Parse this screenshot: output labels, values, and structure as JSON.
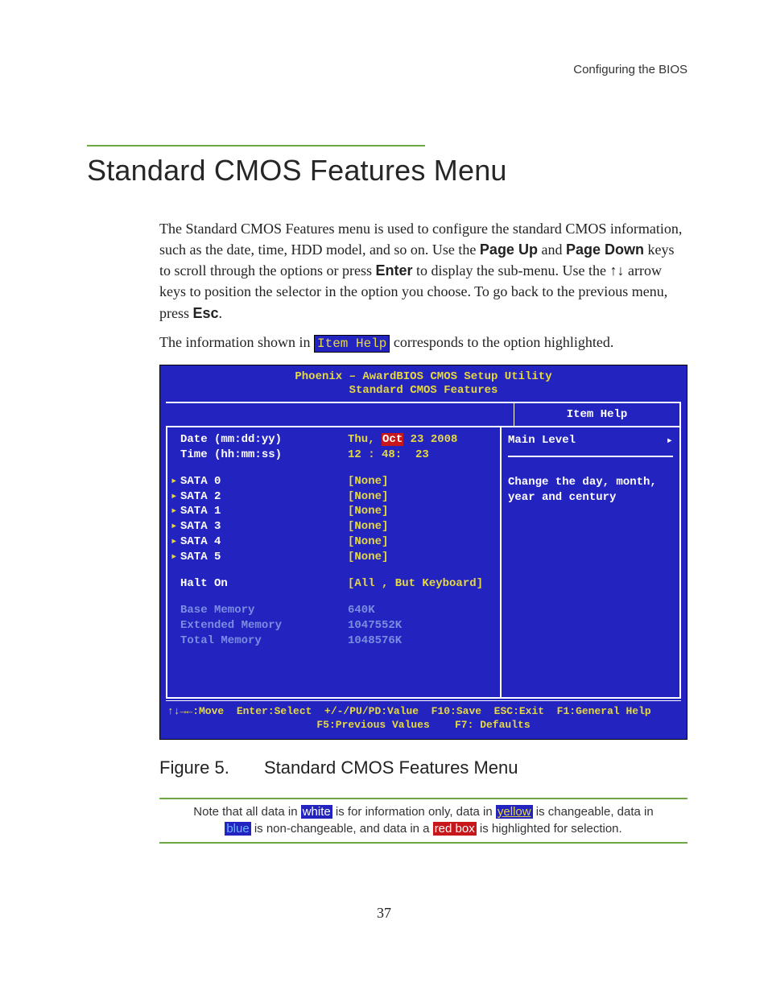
{
  "running_head": "Configuring the BIOS",
  "section_title": "Standard CMOS Features Menu",
  "para1": {
    "t1": "The Standard CMOS Features menu is used to configure the standard CMOS information, such as the date, time, HDD model, and so on. Use the ",
    "b1": "Page Up",
    "t2": " and ",
    "b2": "Page Down",
    "t3": " keys to scroll through the options or press ",
    "b3": "Enter",
    "t4": " to display the sub-menu. Use the ",
    "arrows": "↑↓",
    "t5": " arrow keys to position the selector in the option you choose. To go back to the previous menu, press ",
    "b4": "Esc",
    "t6": "."
  },
  "para2": {
    "t1": "The information shown in ",
    "badge": "Item Help",
    "t2": " corresponds to the option highlighted."
  },
  "bios": {
    "head1": "Phoenix – AwardBIOS CMOS Setup Utility",
    "head2": "Standard CMOS Features",
    "date_label": "Date (mm:dd:yy)",
    "date_val_pre": "Thu, ",
    "date_val_sel": "Oct",
    "date_val_post": " 23 2008",
    "time_label": "Time (hh:mm:ss)",
    "time_val": "12 : 48:  23",
    "sata": [
      {
        "label": "SATA 0",
        "val": "[None]"
      },
      {
        "label": "SATA 2",
        "val": "[None]"
      },
      {
        "label": "SATA 1",
        "val": "[None]"
      },
      {
        "label": "SATA 3",
        "val": "[None]"
      },
      {
        "label": "SATA 4",
        "val": "[None]"
      },
      {
        "label": "SATA 5",
        "val": "[None]"
      }
    ],
    "halt_label": "Halt On",
    "halt_val": "[All , But Keyboard]",
    "mem": [
      {
        "label": "Base Memory",
        "val": "640K"
      },
      {
        "label": "Extended Memory",
        "val": "1047552K"
      },
      {
        "label": "Total Memory",
        "val": "1048576K"
      }
    ],
    "right": {
      "title": "Item Help",
      "level": "Main Level",
      "help": "Change the day, month, year and century"
    },
    "footer1": "↑↓→←:Move  Enter:Select  +/-/PU/PD:Value  F10:Save  ESC:Exit  F1:General Help",
    "footer2": "F5:Previous Values    F7: Defaults"
  },
  "figure": {
    "no": "Figure 5.",
    "title": "Standard CMOS Features Menu"
  },
  "note": {
    "t1": "Note that all data in ",
    "white": "white",
    "t2": " is for information only, data in ",
    "yellow": "yellow",
    "t3": " is changeable, data in ",
    "blue": "blue",
    "t4": " is non-changeable, and data in a ",
    "red": "red box",
    "t5": " is highlighted for selection."
  },
  "page_number": "37"
}
